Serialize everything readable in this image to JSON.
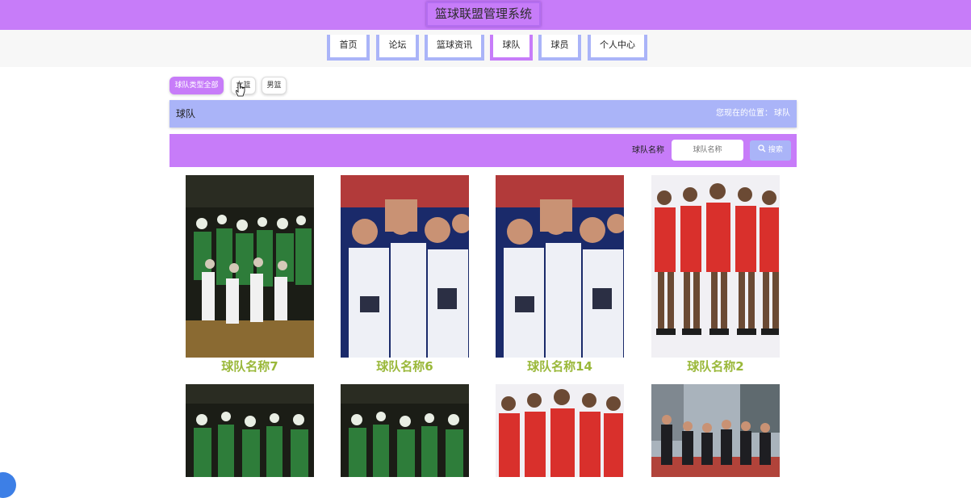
{
  "header": {
    "title": "篮球联盟管理系统"
  },
  "nav": {
    "items": [
      {
        "label": "首页"
      },
      {
        "label": "论坛"
      },
      {
        "label": "篮球资讯"
      },
      {
        "label": "球队"
      },
      {
        "label": "球员"
      },
      {
        "label": "个人中心"
      }
    ],
    "active": "球队"
  },
  "filters": {
    "items": [
      {
        "label": "球队类型全部"
      },
      {
        "label": "女篮"
      },
      {
        "label": "男篮"
      }
    ],
    "active": "球队类型全部"
  },
  "breadcrumb": {
    "title": "球队",
    "location_prefix": "您现在的位置：",
    "location_current": "球队"
  },
  "search": {
    "label": "球队名称",
    "placeholder": "球队名称",
    "button_label": "搜索"
  },
  "teams": [
    {
      "name": "球队名称7",
      "photo": "celebration-crowd"
    },
    {
      "name": "球队名称6",
      "photo": "team-huddle"
    },
    {
      "name": "球队名称14",
      "photo": "team-huddle"
    },
    {
      "name": "球队名称2",
      "photo": "red-jersey-lineup"
    },
    {
      "name": "",
      "photo": "celebration-crowd"
    },
    {
      "name": "",
      "photo": "celebration-crowd"
    },
    {
      "name": "",
      "photo": "red-jersey-lineup"
    },
    {
      "name": "",
      "photo": "outdoor-court-group"
    }
  ],
  "colors": {
    "primary": "#c77cf9",
    "secondary": "#aab4f8",
    "team_name": "#9ab83a"
  }
}
